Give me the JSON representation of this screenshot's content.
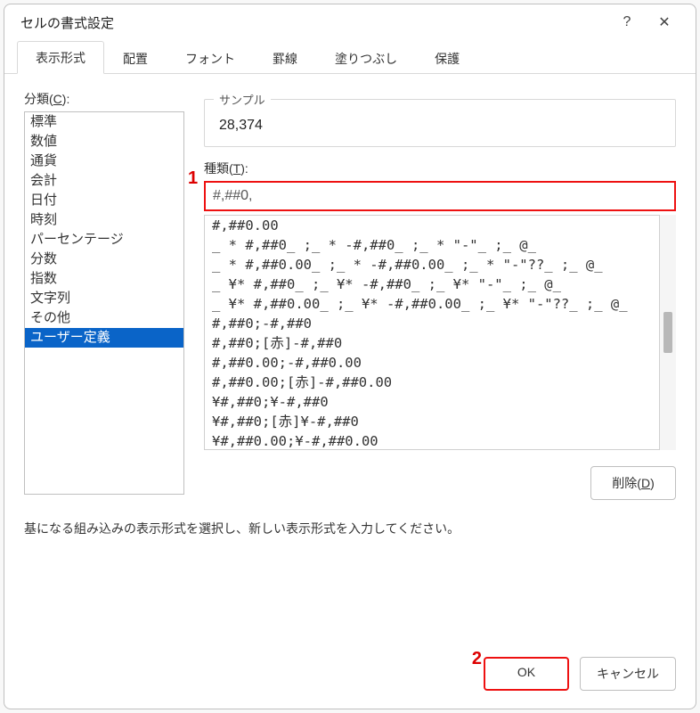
{
  "dialog": {
    "title": "セルの書式設定",
    "help_icon": "?",
    "close_icon": "✕"
  },
  "tabs": [
    {
      "label": "表示形式",
      "active": true
    },
    {
      "label": "配置"
    },
    {
      "label": "フォント"
    },
    {
      "label": "罫線"
    },
    {
      "label": "塗りつぶし"
    },
    {
      "label": "保護"
    }
  ],
  "category": {
    "label_prefix": "分類(",
    "label_accel": "C",
    "label_suffix": "):",
    "items": [
      "標準",
      "数値",
      "通貨",
      "会計",
      "日付",
      "時刻",
      "パーセンテージ",
      "分数",
      "指数",
      "文字列",
      "その他",
      "ユーザー定義"
    ],
    "selected_index": 11
  },
  "sample": {
    "legend": "サンプル",
    "value": "28,374"
  },
  "type": {
    "label_prefix": "種類(",
    "label_accel": "T",
    "label_suffix": "):",
    "value": "#,##0,",
    "annotation": "1"
  },
  "format_list": [
    "#,##0.00",
    "_ * #,##0_ ;_ * -#,##0_ ;_ * \"-\"_ ;_ @_",
    "_ * #,##0.00_ ;_ * -#,##0.00_ ;_ * \"-\"??_ ;_ @_",
    "_ ¥* #,##0_ ;_ ¥* -#,##0_ ;_ ¥* \"-\"_ ;_ @_",
    "_ ¥* #,##0.00_ ;_ ¥* -#,##0.00_ ;_ ¥* \"-\"??_ ;_ @_",
    "#,##0;-#,##0",
    "#,##0;[赤]-#,##0",
    "#,##0.00;-#,##0.00",
    "#,##0.00;[赤]-#,##0.00",
    "¥#,##0;¥-#,##0",
    "¥#,##0;[赤]¥-#,##0",
    "¥#,##0.00;¥-#,##0.00"
  ],
  "delete_button": {
    "label_prefix": "削除(",
    "label_accel": "D",
    "label_suffix": ")"
  },
  "help_text": "基になる組み込みの表示形式を選択し、新しい表示形式を入力してください。",
  "buttons": {
    "ok": "OK",
    "cancel": "キャンセル",
    "ok_annotation": "2"
  }
}
